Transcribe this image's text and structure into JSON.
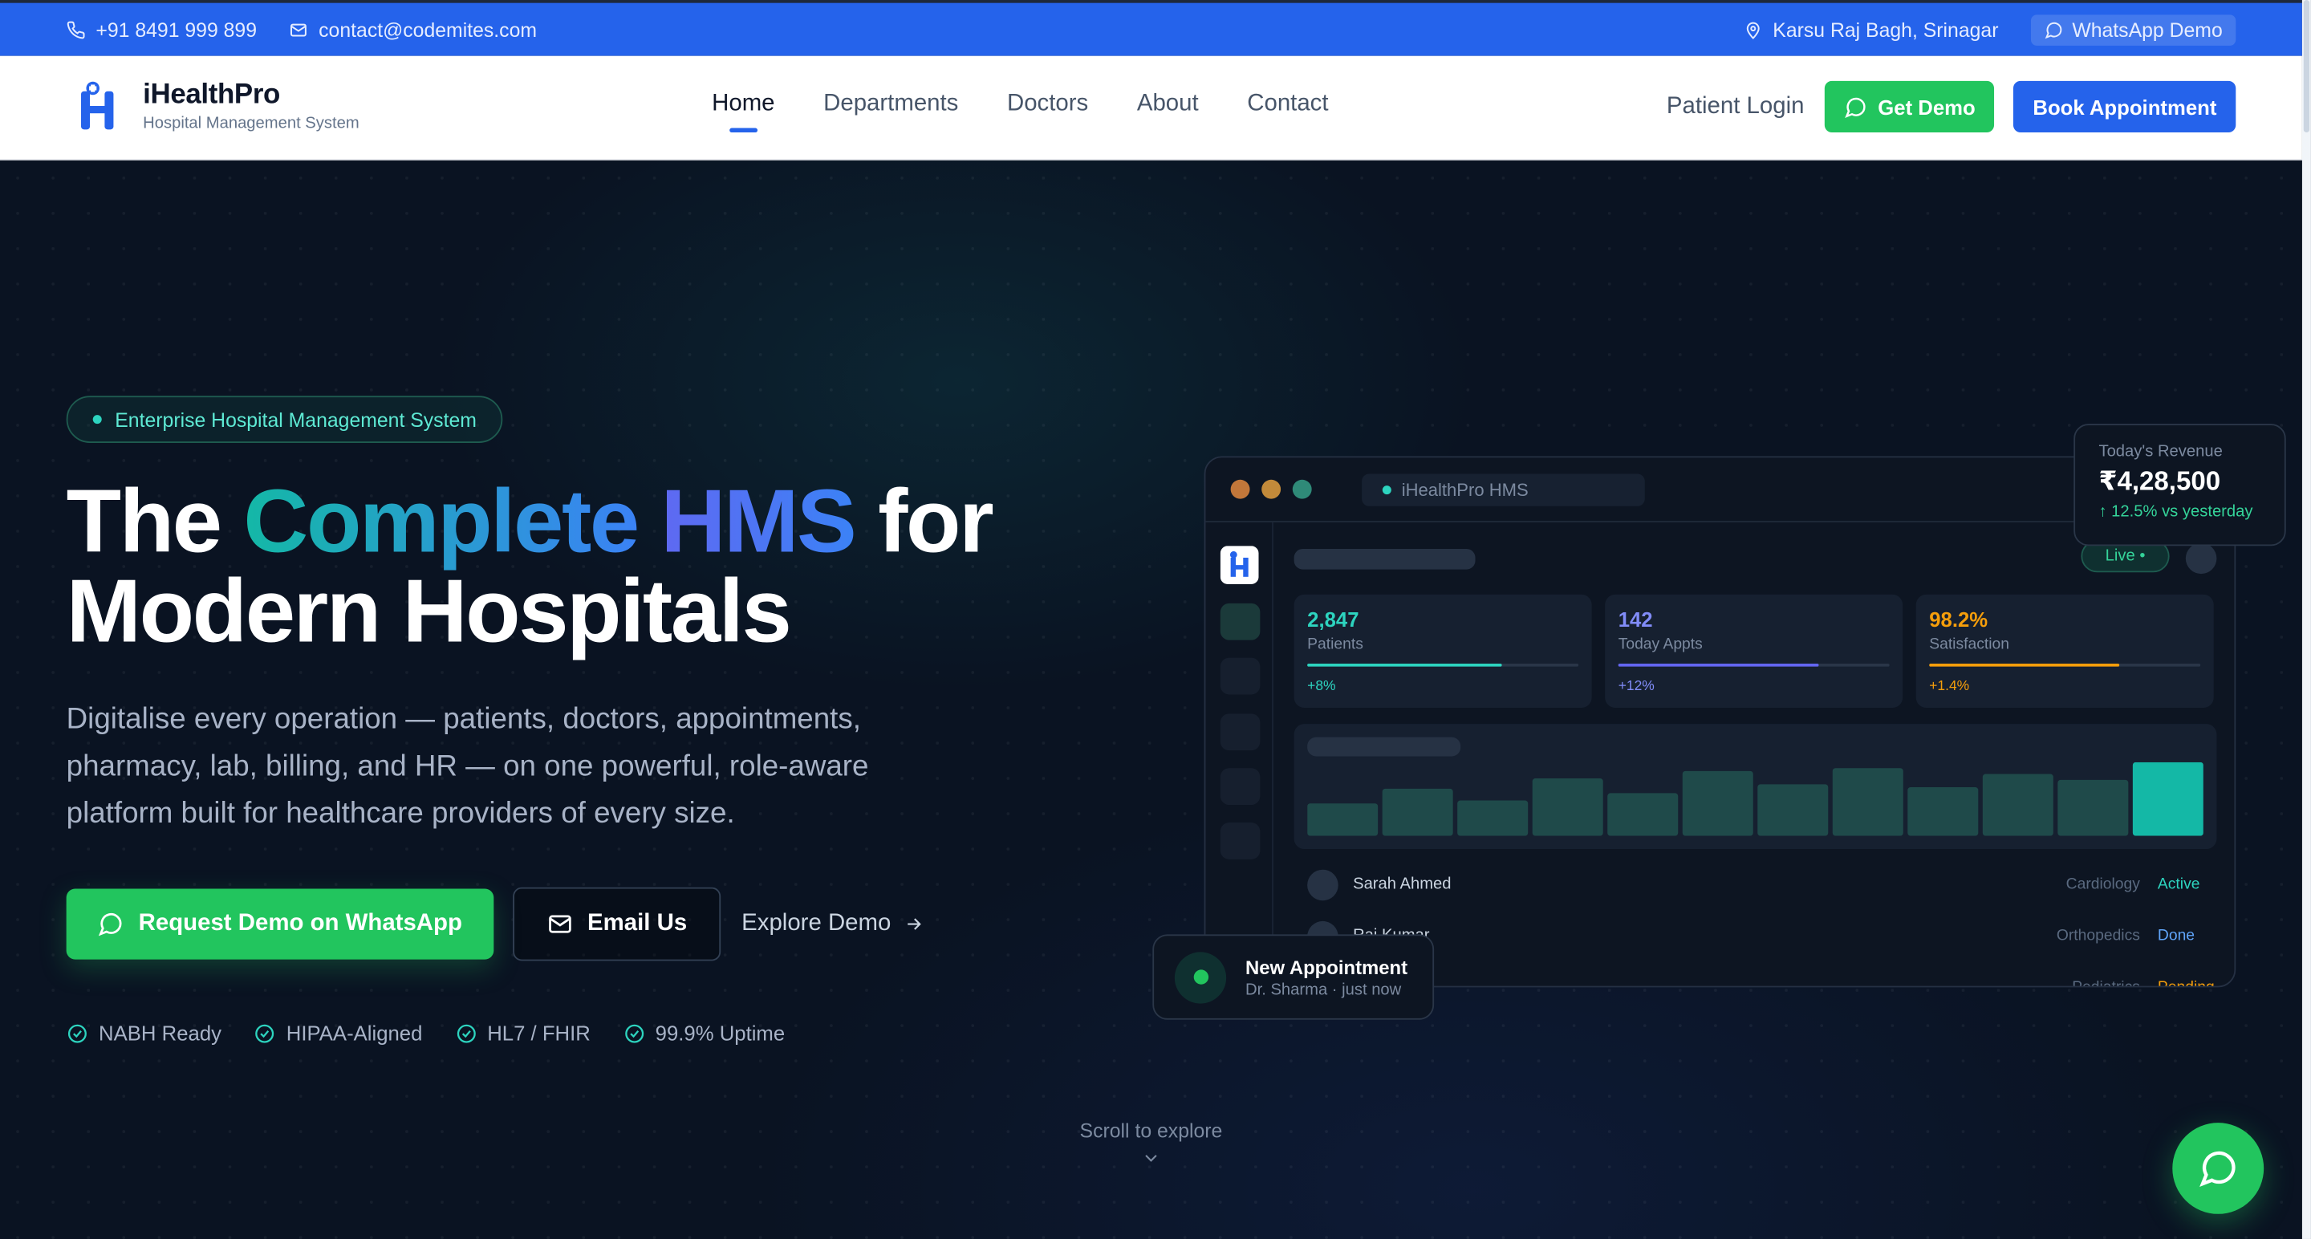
{
  "topbar": {
    "phone": "+91 8491 999 899",
    "email": "contact@codemites.com",
    "location": "Karsu Raj Bagh, Srinagar",
    "whatsapp": "WhatsApp Demo"
  },
  "brand": {
    "name": "iHealthPro",
    "tagline": "Hospital Management System"
  },
  "nav": {
    "items": [
      {
        "label": "Home",
        "active": true
      },
      {
        "label": "Departments"
      },
      {
        "label": "Doctors"
      },
      {
        "label": "About"
      },
      {
        "label": "Contact"
      }
    ],
    "login": "Patient Login",
    "get_demo": "Get Demo",
    "book": "Book Appointment"
  },
  "hero": {
    "badge": "Enterprise Hospital Management System",
    "title_1": "The ",
    "title_2": "Complete",
    "title_3": " HMS",
    "title_4": " for",
    "title_5": "Modern Hospitals",
    "subtitle": "Digitalise every operation — patients, doctors, appointments, pharmacy, lab, billing, and HR — on one powerful, role-aware platform built for healthcare providers of every size.",
    "cta_whatsapp": "Request Demo on WhatsApp",
    "cta_email": "Email Us",
    "cta_explore": "Explore Demo",
    "trust": [
      "NABH Ready",
      "HIPAA-Aligned",
      "HL7 / FHIR",
      "99.9% Uptime"
    ],
    "scroll_hint": "Scroll to explore"
  },
  "dashboard": {
    "url": "iHealthPro HMS",
    "live": "Live •",
    "stats": [
      {
        "value": "2,847",
        "label": "Patients",
        "change": "+8%",
        "color": "#2dd4bf",
        "progress": 0.72
      },
      {
        "value": "142",
        "label": "Today Appts",
        "change": "+12%",
        "color": "#6366f1",
        "progress": 0.74
      },
      {
        "value": "98.2%",
        "label": "Satisfaction",
        "change": "+1.4%",
        "color": "#f59e0b",
        "progress": 0.7
      }
    ],
    "bars": [
      0.44,
      0.64,
      0.48,
      0.78,
      0.58,
      0.88,
      0.7,
      0.92,
      0.66,
      0.84,
      0.76,
      1.0
    ],
    "rows": [
      {
        "name": "Sarah Ahmed",
        "dept": "Cardiology",
        "status": "Active",
        "color": "#2dd4bf"
      },
      {
        "name": "Raj Kumar",
        "dept": "Orthopedics",
        "status": "Done",
        "color": "#60a5fa"
      },
      {
        "name": "",
        "dept": "Pediatrics",
        "status": "Pending",
        "color": "#f59e0b"
      }
    ]
  },
  "revenue_card": {
    "title": "Today's Revenue",
    "amount": "₹4,28,500",
    "growth": "↑ 12.5% vs yesterday"
  },
  "appointment_card": {
    "title": "New Appointment",
    "sub": "Dr. Sharma · just now"
  },
  "colors": {
    "primary": "#2563eb",
    "whatsapp": "#22c55e",
    "teal": "#2dd4bf",
    "hero_bg": "#0a1322"
  }
}
